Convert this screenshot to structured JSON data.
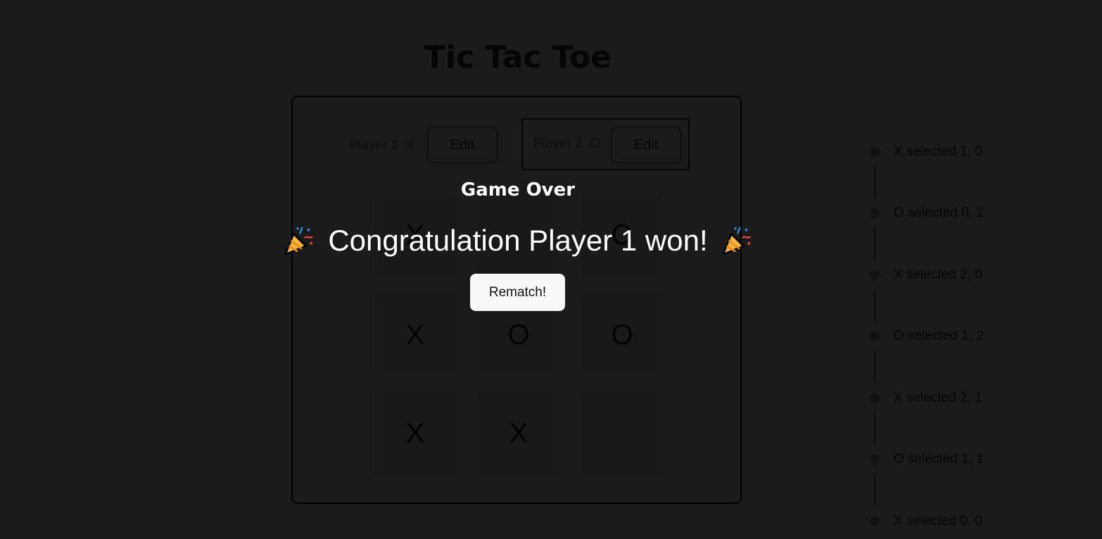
{
  "title": "Tic Tac Toe",
  "players": [
    {
      "name": "Player 1",
      "symbol": "X",
      "edit_label": "Edit"
    },
    {
      "name": "Player 2",
      "symbol": "O",
      "edit_label": "Edit"
    }
  ],
  "board": [
    [
      "X",
      "",
      "O"
    ],
    [
      "X",
      "O",
      "O"
    ],
    [
      "X",
      "X",
      ""
    ]
  ],
  "log": [
    "X selected 1, 0",
    "O selected 0, 2",
    "X selected 2, 0",
    "O selected 1, 2",
    "X selected 2, 1",
    "O selected 1, 1",
    "X selected 0, 0"
  ],
  "modal": {
    "heading": "Game Over",
    "message": "Congratulation Player 1 won!",
    "rematch_label": "Rematch!",
    "icon": "party-popper-icon"
  },
  "colors": {
    "background": "#1b1b1b",
    "modal_text": "#ffffff",
    "button_bg": "#f8f8f8"
  }
}
